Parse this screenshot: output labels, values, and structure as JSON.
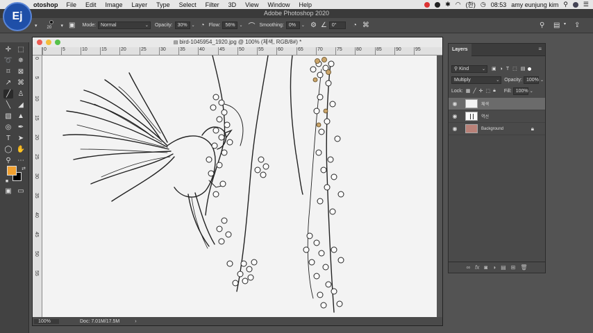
{
  "menubar": {
    "app": "otoshop",
    "items": [
      "File",
      "Edit",
      "Image",
      "Layer",
      "Type",
      "Select",
      "Filter",
      "3D",
      "View",
      "Window",
      "Help"
    ],
    "input_lang": "(한)",
    "time": "08:53",
    "user": "amy eunjung kim"
  },
  "avatar": {
    "initials": "Ej"
  },
  "app_title": "Adobe Photoshop 2020",
  "options": {
    "brush_size": "20",
    "mode_label": "Mode:",
    "mode_value": "Normal",
    "opacity_label": "Opacity:",
    "opacity_value": "30%",
    "flow_label": "Flow:",
    "flow_value": "56%",
    "smoothing_label": "Smoothing:",
    "smoothing_value": "0%",
    "angle_value": "0°"
  },
  "document": {
    "title": "bird-1045954_1920.jpg @ 100% (체색, RGB/8#) *",
    "ruler_h": [
      "0",
      "5",
      "10",
      "15",
      "20",
      "25",
      "30",
      "35",
      "40",
      "45",
      "50",
      "55",
      "60",
      "65",
      "70",
      "75",
      "80",
      "85",
      "90",
      "95"
    ],
    "ruler_v": [
      "0",
      "5",
      "10",
      "15",
      "20",
      "25",
      "30",
      "35",
      "40",
      "45",
      "50",
      "55"
    ],
    "zoom": "100%",
    "doc_size": "Doc: 7.01M/17.5M",
    "status_arrow": "›"
  },
  "layers_panel": {
    "tab": "Layers",
    "filter_kind": "Kind",
    "blend_mode": "Multiply",
    "opacity_label": "Opacity:",
    "opacity_value": "100%",
    "lock_label": "Lock:",
    "fill_label": "Fill:",
    "fill_value": "100%",
    "layers": [
      {
        "name": "체색",
        "active": true
      },
      {
        "name": "역선",
        "active": false
      },
      {
        "name": "Background",
        "active": false
      }
    ]
  }
}
